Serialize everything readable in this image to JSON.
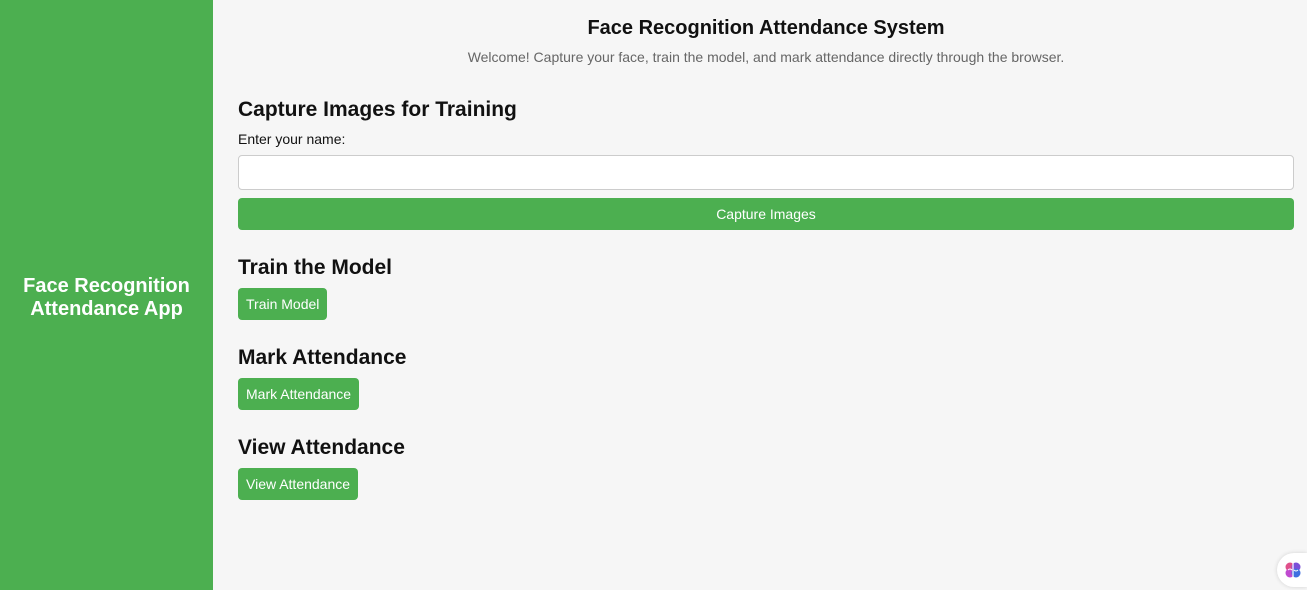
{
  "sidebar": {
    "title": "Face Recognition Attendance App"
  },
  "header": {
    "title": "Face Recognition Attendance System",
    "subtitle": "Welcome! Capture your face, train the model, and mark attendance directly through the browser."
  },
  "capture": {
    "heading": "Capture Images for Training",
    "label": "Enter your name:",
    "name_value": "",
    "button_label": "Capture Images"
  },
  "train": {
    "heading": "Train the Model",
    "button_label": "Train Model"
  },
  "mark": {
    "heading": "Mark Attendance",
    "button_label": "Mark Attendance"
  },
  "view": {
    "heading": "View Attendance",
    "button_label": "View Attendance"
  },
  "colors": {
    "accent": "#4caf50",
    "background": "#f6f6f6"
  },
  "icons": {
    "corner_widget": "brain-icon"
  }
}
